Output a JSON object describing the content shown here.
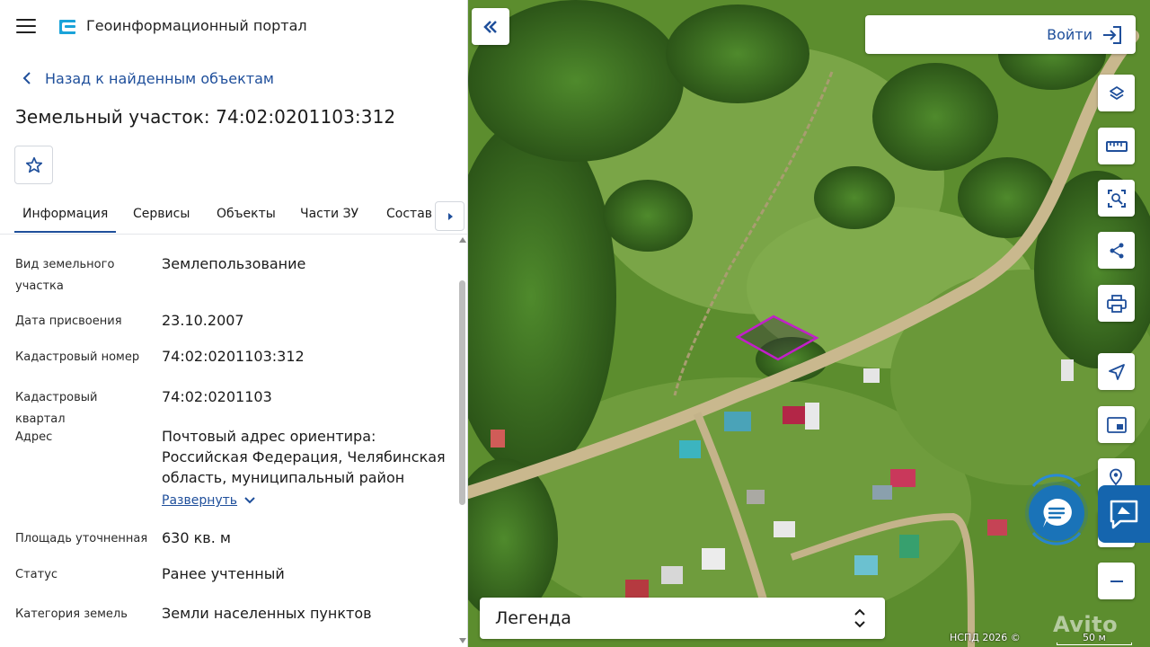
{
  "header": {
    "app_title": "Геоинформационный портал"
  },
  "nav": {
    "back_label": "Назад к найденным объектам"
  },
  "object": {
    "title": "Земельный участок: 74:02:0201103:312"
  },
  "tabs": [
    {
      "label": "Информация",
      "active": true
    },
    {
      "label": "Сервисы"
    },
    {
      "label": "Объекты"
    },
    {
      "label": "Части ЗУ"
    },
    {
      "label": "Состав"
    }
  ],
  "info": {
    "rows": [
      {
        "label": "Вид земельного участка",
        "value": "Землепользование"
      },
      {
        "label": "Дата присвоения",
        "value": "23.10.2007"
      },
      {
        "label": "Кадастровый номер",
        "value": "74:02:0201103:312"
      },
      {
        "label": "Кадастровый квартал",
        "value": "74:02:0201103"
      },
      {
        "label": "Адрес",
        "value": "Почтовый адрес ориентира: Российская Федерация, Челябинская область, муниципальный район"
      },
      {
        "label": "Площадь уточненная",
        "value": "630 кв. м"
      },
      {
        "label": "Статус",
        "value": "Ранее учтенный"
      },
      {
        "label": "Категория земель",
        "value": "Земли населенных пунктов"
      }
    ],
    "expand_label": "Развернуть"
  },
  "map": {
    "login_label": "Войти",
    "legend_label": "Легенда",
    "attribution": "НСПД 2026 ©",
    "scale_label": "50 м",
    "watermark": "Avito",
    "parcel_color": "#c21fc9",
    "tools": [
      "layers-icon",
      "ruler-icon",
      "area-select-icon",
      "share-icon",
      "print-icon",
      "locate-icon",
      "minimap-icon",
      "geo-search-icon",
      "zoom-in-icon",
      "zoom-out-icon"
    ]
  },
  "colors": {
    "accent": "#1f4f9b",
    "chat": "#1a73b8"
  }
}
